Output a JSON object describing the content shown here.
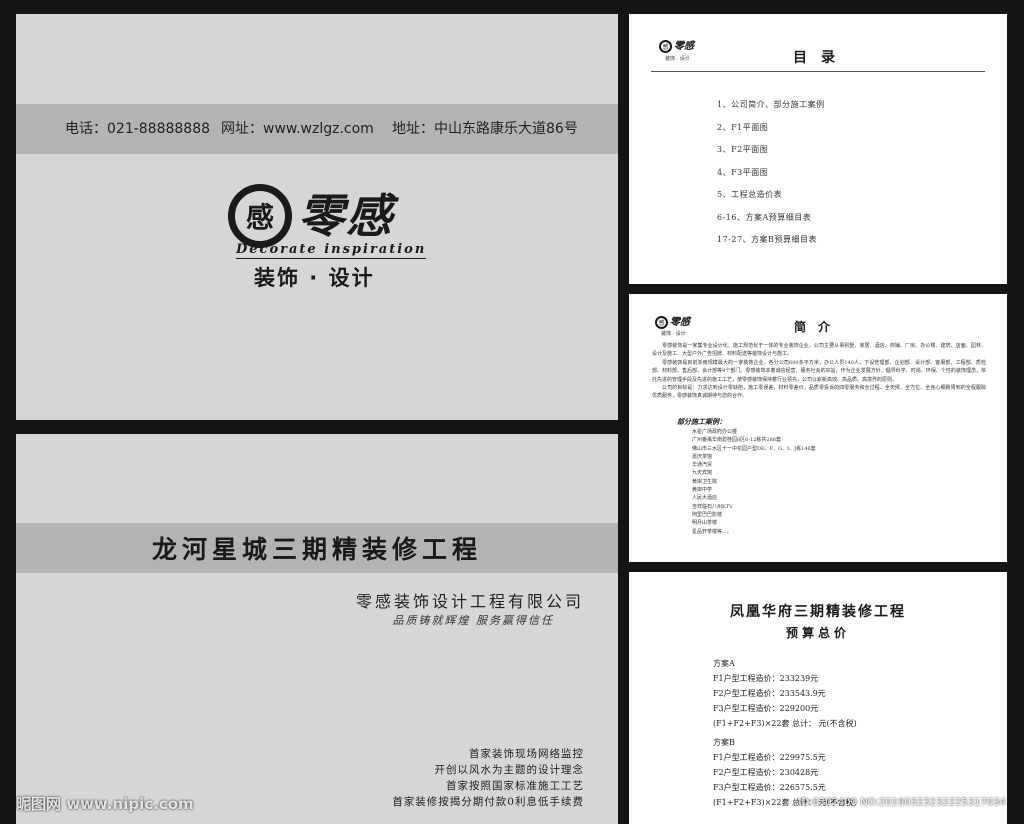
{
  "front_cover": {
    "phone": "电话：021-88888888",
    "website": "网址：www.wzlgz.com",
    "address": "地址：中山东路康乐大道86号",
    "logo_mark": "感",
    "logo_script": "零感",
    "logo_english": "Decorate inspiration",
    "logo_subtitle": "装饰 · 设计"
  },
  "back_cover": {
    "project_title": "龙河星城三期精装修工程",
    "company": "零感装饰设计工程有限公司",
    "slogan": "品质铸就辉煌    服务赢得信任",
    "features": [
      "首家装饰现场网络监控",
      "开创以风水为主题的设计理念",
      "首家按照国家标准施工工艺",
      "首家装修按揭分期付款0利息低手续费"
    ]
  },
  "mini_logo": {
    "mark": "感",
    "text": "零感",
    "sub": "装饰 · 设计"
  },
  "toc": {
    "title": "目录",
    "items": [
      "1、公司简介、部分施工案例",
      "2、F1平面图",
      "3、F2平面图",
      "4、F3平面图",
      "5、工程总造价表",
      "6-16、方案A预算细目表",
      "17-27、方案B预算细目表"
    ]
  },
  "intro": {
    "title": "简介",
    "paragraphs": [
      "零感装饰是一家集专业设计化、施工规范化于一体的专业装饰企业。公司主要从事别墅、家居、酒店、商铺、厂房、办公楼、建筑、店面、园林、设计及施工、大型户外广告招牌、材料配送等装饰设计与施工。",
      "零感装饰是目前浙南规模最大的一家装饰企业。各分公司600多平方米，办公人员140人，下设管理部、企划部、设计部、客服部、工程部、质检部、材料部、售后部、会计部等9个部门。零感装饰本着诚信经营、服务社会的宗旨，作为企业发展方针，倡导科学、时尚、环保、个性的装饰理念，依托先进的管理手段及先进的施工工艺，使零感装饰保持着行业领先，公司以崭新高效、高品质、高境界的原则。",
      "公司的目标是：力求达到设计零缺陷，施工零误差，材料零差价，品质零投诉的四零服务和全过程、全天候、全方位、全身心细致周到的全程跟踪优质服务，零感装饰真诚期待与您的合作。"
    ],
    "cases_title": "部分施工案例：",
    "cases": [
      "水星广场政府办公楼",
      "广州番禺华南碧桂园8区6-12栋共288套",
      "佛山市三水区十一中花园户型DE、F、G、I、J栋146套",
      "嘉庆茶馆",
      "华通汽贸",
      "九天宾馆",
      "黄岸卫生院",
      "黄岸中学",
      "人民大酒店",
      "吉祥临石八州KTV",
      "阿里巴巴影楼",
      "明月山茶楼",
      "星品轩茶楼等。。。"
    ]
  },
  "budget": {
    "title": "凤凰华府三期精装修工程",
    "subtitle": "预算总价",
    "plan_a": [
      "方案A",
      "F1户型工程造价：233239元",
      "F2户型工程造价：233543.9元",
      "F3户型工程造价：229200元",
      "(F1+F2+F3)×22套 总计：         元(不含税)"
    ],
    "plan_b": [
      "方案B",
      "F1户型工程造价：229975.5元",
      "F2户型工程造价：230428元",
      "F3户型工程造价：226575.5元",
      "(F1+F2+F3)×22套 总计：         元(不含税)"
    ]
  },
  "watermark": {
    "left": "昵图网 www.nipic.com",
    "right": "ID:8302400 NO:20190323232225317034"
  }
}
